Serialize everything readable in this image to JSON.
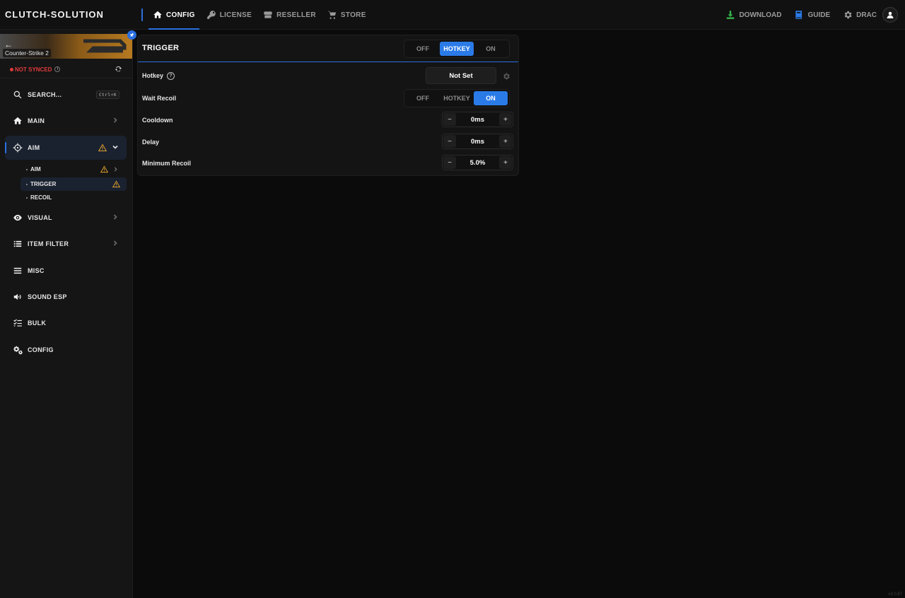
{
  "app": {
    "brand": "CLUTCH-SOLUTION",
    "version": "v3.0.87"
  },
  "nav": {
    "tabs": [
      {
        "label": "CONFIG",
        "icon": "home-icon",
        "active": true
      },
      {
        "label": "LICENSE",
        "icon": "key-icon",
        "active": false
      },
      {
        "label": "RESELLER",
        "icon": "store-icon",
        "active": false
      },
      {
        "label": "STORE",
        "icon": "cart-icon",
        "active": false
      }
    ],
    "right": {
      "download": "DOWNLOAD",
      "guide": "GUIDE",
      "user": "DRAC"
    }
  },
  "sidebar": {
    "game": {
      "name": "Counter-Strike 2"
    },
    "sync": {
      "status": "NOT SYNCED",
      "status_color": "#e03a3a"
    },
    "search": {
      "label": "SEARCH...",
      "shortcut": "Ctrl+K"
    },
    "items": [
      {
        "label": "MAIN",
        "icon": "home-icon"
      },
      {
        "label": "AIM",
        "icon": "crosshair-icon",
        "expanded": true,
        "warning": true
      },
      {
        "label": "VISUAL",
        "icon": "eye-icon"
      },
      {
        "label": "ITEM FILTER",
        "icon": "list-icon"
      },
      {
        "label": "MISC",
        "icon": "menu-icon"
      },
      {
        "label": "SOUND ESP",
        "icon": "speaker-icon"
      },
      {
        "label": "BULK",
        "icon": "checklist-icon"
      },
      {
        "label": "CONFIG",
        "icon": "gears-icon"
      }
    ],
    "aim_sub": [
      {
        "label": "AIM",
        "warning": true
      },
      {
        "label": "TRIGGER",
        "warning": true,
        "active": true
      },
      {
        "label": "RECOIL"
      }
    ]
  },
  "trigger": {
    "title": "TRIGGER",
    "mode_options": [
      "OFF",
      "HOTKEY",
      "ON"
    ],
    "mode_selected": "HOTKEY",
    "hotkey": {
      "label": "Hotkey",
      "value": "Not Set"
    },
    "wait_recoil": {
      "label": "Wait Recoil",
      "options": [
        "OFF",
        "HOTKEY",
        "ON"
      ],
      "selected": "ON"
    },
    "cooldown": {
      "label": "Cooldown",
      "value": "0ms"
    },
    "delay": {
      "label": "Delay",
      "value": "0ms"
    },
    "minimum_recoil": {
      "label": "Minimum Recoil",
      "value": "5.0%"
    }
  },
  "colors": {
    "accent": "#2a7be8",
    "warning": "#e0a030",
    "download": "#35b24a",
    "guide": "#2a7be8"
  }
}
